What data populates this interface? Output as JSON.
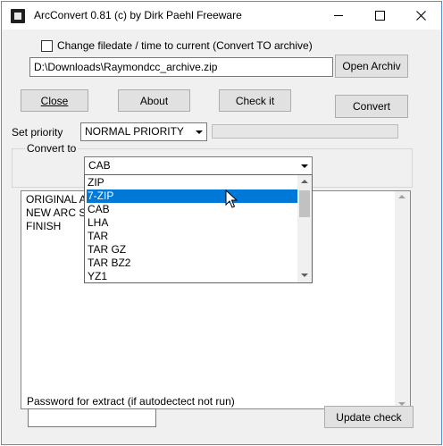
{
  "window": {
    "title": "ArcConvert 0.81 (c) by Dirk Paehl Freeware"
  },
  "checkbox": {
    "label": "Change filedate / time to current (Convert TO archive)",
    "checked": false
  },
  "path_input": {
    "value": "D:\\Downloads\\Raymondcc_archive.zip"
  },
  "buttons": {
    "open": "Open Archiv",
    "close": "Close",
    "about": "About",
    "check": "Check it",
    "convert": "Convert",
    "update": "Update check"
  },
  "priority": {
    "label": "Set priority",
    "value": "NORMAL PRIORITY"
  },
  "convert_to": {
    "label": "Convert to",
    "value": "CAB",
    "options": [
      "ZIP",
      "7-ZIP",
      "CAB",
      "LHA",
      "TAR",
      "TAR GZ",
      "TAR BZ2",
      "YZ1"
    ],
    "highlighted": "7-ZIP"
  },
  "log": {
    "lines": [
      "ORIGINAL AR",
      "NEW ARC SIZ",
      "FINISH"
    ]
  },
  "password": {
    "label": "Password for extract (if autodectect not run)",
    "value": ""
  },
  "colors": {
    "selection": "#0078d7",
    "window_border": "#5a8fcf"
  },
  "icons": [
    "app-icon",
    "minimize-icon",
    "maximize-icon",
    "close-icon",
    "checkbox-icon",
    "chevron-down-icon",
    "chevron-up-icon",
    "mouse-cursor-icon"
  ]
}
